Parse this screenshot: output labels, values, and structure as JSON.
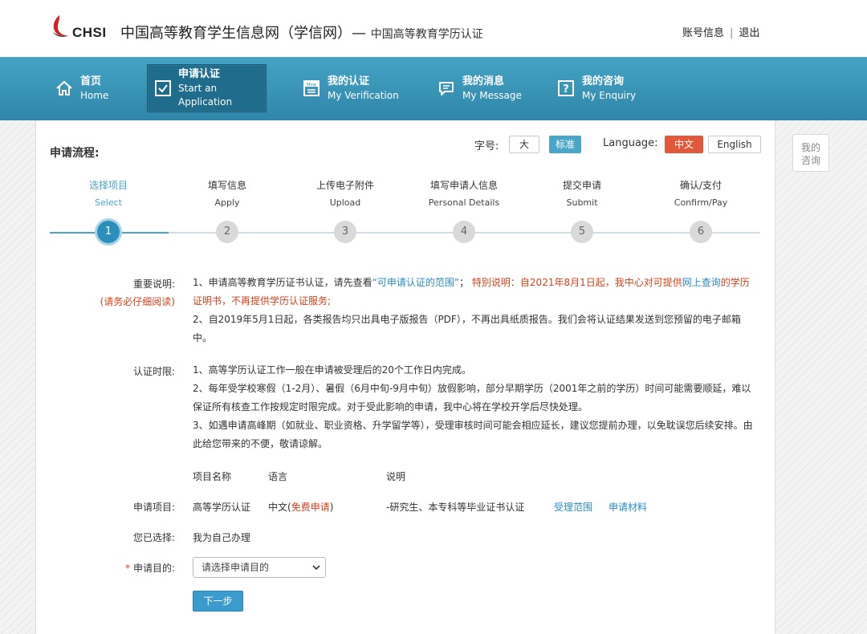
{
  "header": {
    "logo_text": "CHSI",
    "site_title": "中国高等教育学生信息网（学信网）—",
    "site_subtitle": "中国高等教育学历认证",
    "account_label": "账号信息",
    "account_sep": "|",
    "logout_label": "退出"
  },
  "nav": {
    "items": [
      {
        "cn": "首页",
        "en": "Home",
        "icon": "home-icon"
      },
      {
        "cn": "申请认证",
        "en": "Start an Application",
        "icon": "checkbox-icon",
        "active": true
      },
      {
        "cn": "我的认证",
        "en": "My Verification",
        "icon": "mine-icon"
      },
      {
        "cn": "我的消息",
        "en": "My Message",
        "icon": "message-icon"
      },
      {
        "cn": "我的咨询",
        "en": "My Enquiry",
        "icon": "enquiry-icon"
      }
    ]
  },
  "side_tab": {
    "line1": "我的",
    "line2": "咨询"
  },
  "process": {
    "title": "申请流程:",
    "font_size_label": "字号:",
    "font_large": "大",
    "font_standard": "标准",
    "language_label": "Language:",
    "lang_cn": "中文",
    "lang_en": "English",
    "steps": [
      {
        "cn": "选择项目",
        "en": "Select",
        "num": "1"
      },
      {
        "cn": "填写信息",
        "en": "Apply",
        "num": "2"
      },
      {
        "cn": "上传电子附件",
        "en": "Upload",
        "num": "3"
      },
      {
        "cn": "填写申请人信息",
        "en": "Personal Details",
        "num": "4"
      },
      {
        "cn": "提交申请",
        "en": "Submit",
        "num": "5"
      },
      {
        "cn": "确认/支付",
        "en": "Confirm/Pay",
        "num": "6"
      }
    ],
    "active_step": 1
  },
  "notes": {
    "important_label": "重要说明:",
    "important_sub": "(请务必仔细阅读)",
    "n1_a": "1、申请高等教育学历证书认证，请先查看",
    "n1_link": "“可申请认证的范围”",
    "n1_b": "；",
    "n1_red1": "特别说明：自2021年8月1日起，我中心对可提供",
    "n1_link2": "网上查询",
    "n1_red2": "的学历证明书，不再提供学历认证服务;",
    "n2": "2、自2019年5月1日起，各类报告均只出具电子版报告（PDF），不再出具纸质报告。我们会将认证结果发送到您预留的电子邮箱中。",
    "time_label": "认证时限:",
    "t1": "1、高等学历认证工作一般在申请被受理后的20个工作日内完成。",
    "t2": "2、每年受学校寒假（1-2月）、暑假（6月中旬-9月中旬）放假影响，部分早期学历（2001年之前的学历）时间可能需要顺延，难以保证所有核查工作按规定时限完成。对于受此影响的申请，我中心将在学校开学后尽快处理。",
    "t3": "3、如遇申请高峰期（如就业、职业资格、升学留学等），受理审核时间可能会相应延长，建议您提前办理，以免耽误您后续安排。由此给您带来的不便，敬请谅解。"
  },
  "project": {
    "col_name": "项目名称",
    "col_lang": "语言",
    "col_desc": "说明",
    "row_label": "申请项目:",
    "name": "高等学历认证",
    "lang": "中文(",
    "lang_free": "免费申请",
    "lang_close": ")",
    "desc": "-研究生、本专科等毕业证书认证",
    "link_scope": "受理范围",
    "link_materials": "申请材料"
  },
  "selection": {
    "label": "您已选择:",
    "value": "我为自己办理"
  },
  "purpose": {
    "required_mark": "*",
    "label": "申请目的:",
    "placeholder": "请选择申请目的"
  },
  "next_button": "下一步",
  "colors": {
    "nav_bg": "#3996ba",
    "active_nav": "#1f6c8d",
    "accent_blue": "#2b8fba",
    "red": "#d9411c",
    "lang_active": "#e0593a"
  }
}
